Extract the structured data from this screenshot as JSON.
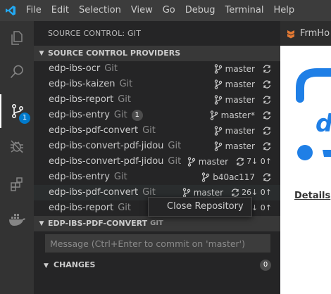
{
  "menu": [
    "File",
    "Edit",
    "Selection",
    "View",
    "Go",
    "Debug",
    "Terminal",
    "Help"
  ],
  "activity_bar": {
    "scm_badge": "1"
  },
  "sidebar": {
    "title": "SOURCE CONTROL: GIT",
    "providers_header": "SOURCE CONTROL PROVIDERS",
    "repos": [
      {
        "name": "edp-ibs-ocr",
        "type": "Git",
        "count": "",
        "branch": "master",
        "ahead_behind": ""
      },
      {
        "name": "edp-ibs-kaizen",
        "type": "Git",
        "count": "",
        "branch": "master",
        "ahead_behind": ""
      },
      {
        "name": "edp-ibs-report",
        "type": "Git",
        "count": "",
        "branch": "master",
        "ahead_behind": ""
      },
      {
        "name": "edp-ibs-entry",
        "type": "Git",
        "count": "1",
        "branch": "master*",
        "ahead_behind": ""
      },
      {
        "name": "edp-ibs-pdf-convert",
        "type": "Git",
        "count": "",
        "branch": "master",
        "ahead_behind": ""
      },
      {
        "name": "edp-ibs-convert-pdf-jidou",
        "type": "Git",
        "count": "",
        "branch": "master",
        "ahead_behind": ""
      },
      {
        "name": "edp-ibs-convert-pdf-jidou",
        "type": "Git",
        "count": "",
        "branch": "master",
        "ahead_behind": "7↓ 0↑"
      },
      {
        "name": "edp-ibs-entry",
        "type": "Git",
        "count": "",
        "branch": "b40ac117",
        "ahead_behind": ""
      },
      {
        "name": "edp-ibs-pdf-convert",
        "type": "Git",
        "count": "",
        "branch": "master",
        "ahead_behind": "26↓ 0↑"
      },
      {
        "name": "edp-ibs-report",
        "type": "Git",
        "count": "",
        "branch": "",
        "ahead_behind": "4↓ 0↑"
      }
    ],
    "repo_section": {
      "name": "EDP-IBS-PDF-CONVERT",
      "sub": "GIT"
    },
    "message_placeholder": "Message (Ctrl+Enter to commit on 'master')",
    "changes_label": "CHANGES",
    "changes_count": "0"
  },
  "context_menu": {
    "item": "Close Repository"
  },
  "editor": {
    "tab_label": "FrmHo",
    "details_label": "Details"
  }
}
